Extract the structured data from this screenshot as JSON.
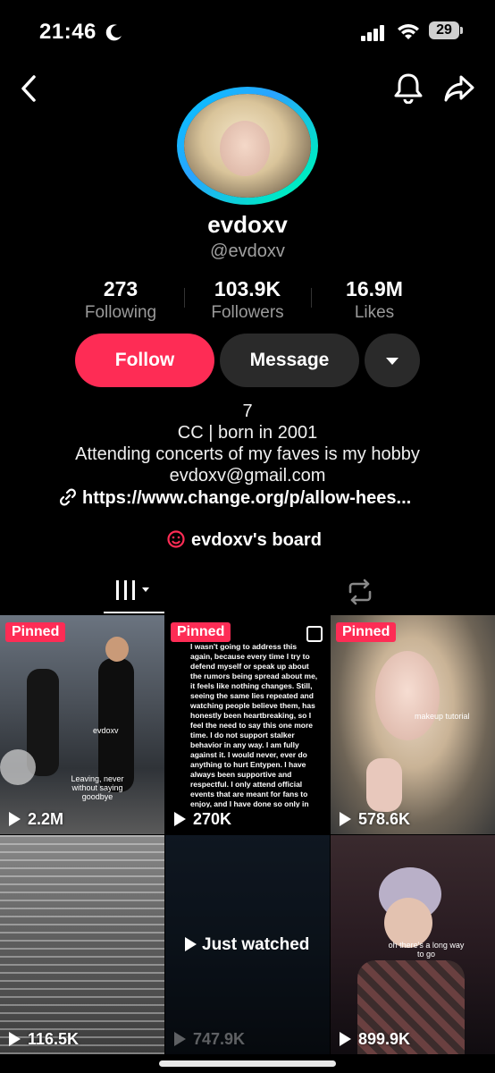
{
  "status_bar": {
    "time": "21:46",
    "battery": "29"
  },
  "profile": {
    "display_name": "evdoxv",
    "username": "@evdoxv",
    "stats": [
      {
        "value": "273",
        "label": "Following"
      },
      {
        "value": "103.9K",
        "label": "Followers"
      },
      {
        "value": "16.9M",
        "label": "Likes"
      }
    ],
    "actions": {
      "follow": "Follow",
      "message": "Message"
    },
    "bio": [
      "7",
      "CC | born in 2001",
      "Attending concerts of my faves is my hobby",
      "evdoxv@gmail.com"
    ],
    "link": "https://www.change.org/p/allow-hees...",
    "board": "evdoxv's board"
  },
  "videos": [
    {
      "pinned": "Pinned",
      "views": "2.2M",
      "captions": [
        "evdoxv",
        "Leaving, never without saying goodbye"
      ]
    },
    {
      "pinned": "Pinned",
      "views": "270K",
      "text": "I wasn't going to address this again, because every time I try to defend myself or speak up about the rumors being spread about me, it feels like nothing changes. Still, seeing the same lies repeated and watching people believe them, has honestly been heartbreaking, so I feel the need to say this one more time. I do not support stalker behavior in any way. I am fully against it. I would never, ever do anything to hurt Entypen. I have always been supportive and respectful. I only attend official events that are meant for fans to enjoy, and I have done so only in Korea and in Europe. I don't follow them everywhere. I simply support them whenever I have the opportunity. I love Enhypen because they inspire me, and I will continue to support them in ways that are respectful and appropriate. I will not accept online bullying or harassment just because some people want to paint me as a bad person. I would truly appreciate it if you could report videos or content that are intentionally trying to harm me based on jealousy or misinformation. Please understand this clearly: I am simply a fan, and I would never, ever cross any line beyond that."
    },
    {
      "pinned": "Pinned",
      "views": "578.6K",
      "captions": [
        "makeup tutorial"
      ]
    },
    {
      "views": "116.5K"
    },
    {
      "views": "747.9K",
      "badge": "Just watched"
    },
    {
      "views": "899.9K",
      "captions": [
        "oh there's a long way to go"
      ]
    }
  ],
  "colors": {
    "accent": "#fe2c55",
    "secondary_button": "#2a2a2a"
  }
}
